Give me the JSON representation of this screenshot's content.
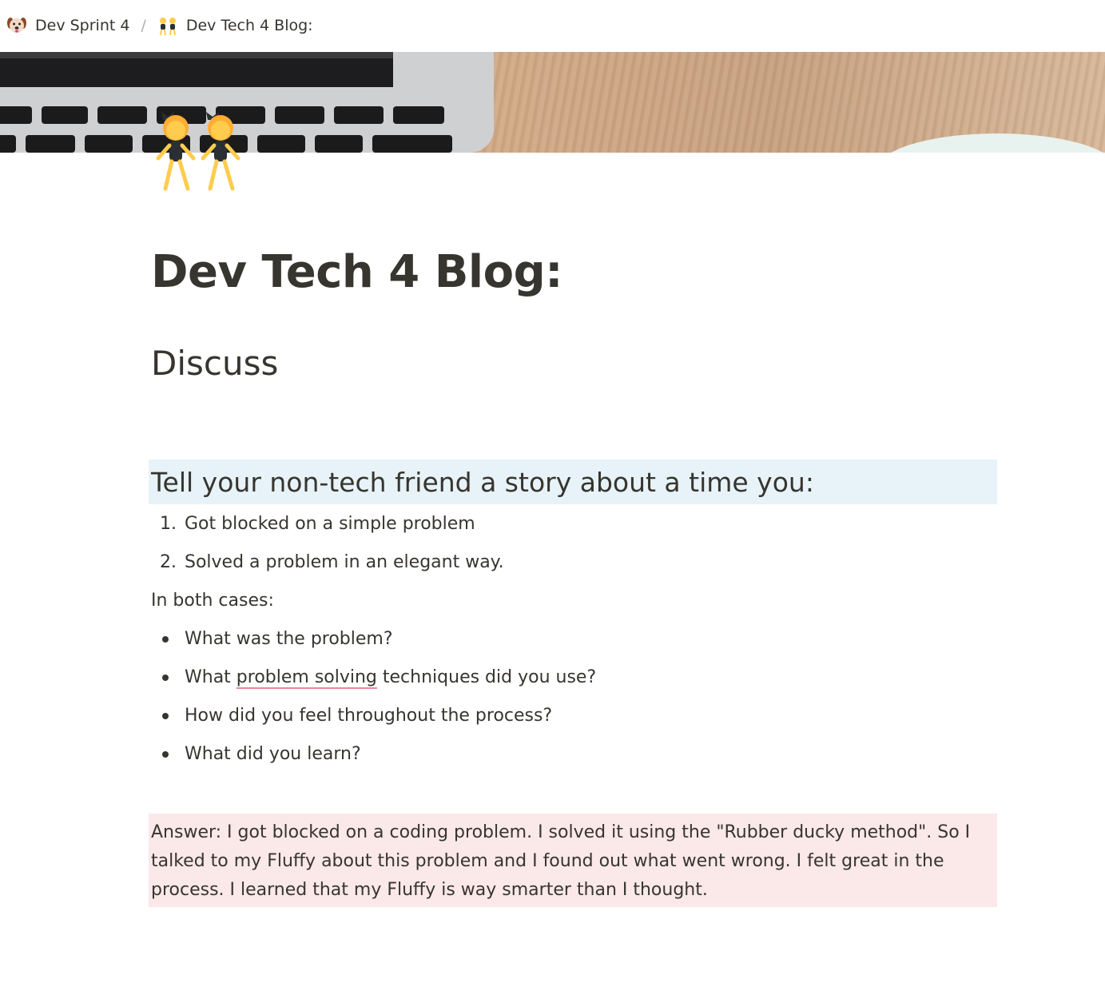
{
  "breadcrumb": {
    "items": [
      {
        "label": "Dev Sprint 4",
        "icon": "dog-face-icon"
      },
      {
        "label": "Dev Tech 4 Blog:",
        "icon": "dancers-icon"
      }
    ],
    "separator": "/"
  },
  "page": {
    "title": "Dev Tech 4 Blog:",
    "icon": "dancers-icon"
  },
  "content": {
    "heading_discuss": "Discuss",
    "callout_heading": "Tell your non-tech friend a story about a time you:",
    "numbered_items": [
      {
        "number": "1.",
        "text": "Got blocked on a simple problem"
      },
      {
        "number": "2.",
        "text": "Solved a problem in an elegant way."
      }
    ],
    "both_cases_label": "In both cases:",
    "bullets": {
      "b1": "What was the problem?",
      "b2_before": "What ",
      "b2_flagged": "problem solving",
      "b2_after": " techniques did you use?",
      "b3": "How did you feel throughout the process?",
      "b4": "What did you learn?"
    },
    "answer": "Answer: I got blocked on a coding problem. I solved it using the \"Rubber ducky method\". So I talked to my Fluffy about this problem and I found out what went wrong. I felt great in the process. I learned that my Fluffy is way smarter than I thought."
  },
  "colors": {
    "text": "#37352f",
    "callout_blue_bg": "#e7f3f8",
    "callout_red_bg": "#fbe8e8",
    "spellcheck_underline": "#e8889c"
  }
}
